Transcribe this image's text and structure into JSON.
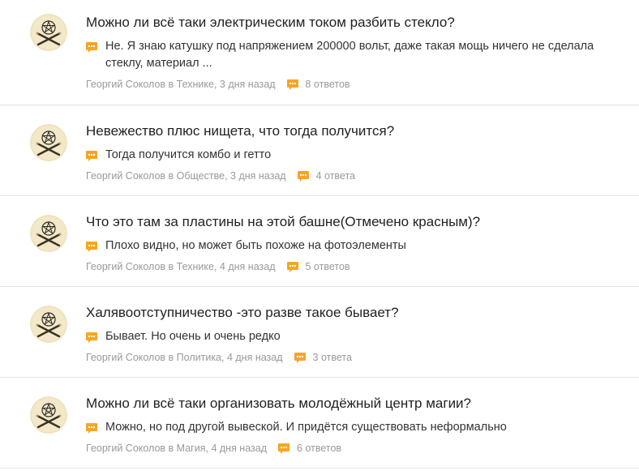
{
  "accent_color": "#f5a623",
  "feed": [
    {
      "title": "Можно ли всё таки электрическим током разбить стекло?",
      "answer": "Не. Я знаю катушку под напряжением 200000 вольт, даже такая мощь ничего не сделала стеклу, материал ...",
      "author": "Георгий Соколов",
      "in": " в ",
      "category": "Технике",
      "time": ", 3 дня назад",
      "answers": "8 ответов"
    },
    {
      "title": "Невежество плюс нищета, что тогда получится?",
      "answer": "Тогда получится комбо и гетто",
      "author": "Георгий Соколов",
      "in": " в ",
      "category": "Обществе",
      "time": ", 3 дня назад",
      "answers": "4 ответа"
    },
    {
      "title": "Что это там за пластины на этой башне(Отмечено красным)?",
      "answer": "Плохо видно, но может быть похоже на фотоэлементы",
      "author": "Георгий Соколов",
      "in": " в ",
      "category": "Технике",
      "time": ", 4 дня назад",
      "answers": "5 ответов"
    },
    {
      "title": "Халявоотступничество -это разве такое бывает?",
      "answer": "Бывает. Но очень и очень редко",
      "author": "Георгий Соколов",
      "in": " в ",
      "category": "Политика",
      "time": ", 4 дня назад",
      "answers": "3 ответа"
    },
    {
      "title": "Можно ли всё таки организовать молодёжный центр магии?",
      "answer": "Можно, но под другой вывеской. И придётся существовать неформально",
      "author": "Георгий Соколов",
      "in": " в ",
      "category": "Магия",
      "time": ", 4 дня назад",
      "answers": "6 ответов"
    }
  ]
}
